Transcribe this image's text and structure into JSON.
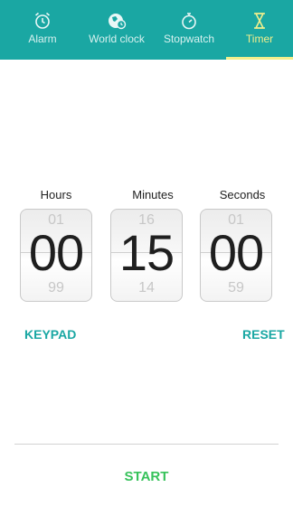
{
  "tabs": [
    {
      "label": "Alarm",
      "icon": "alarm-clock-icon"
    },
    {
      "label": "World clock",
      "icon": "globe-clock-icon"
    },
    {
      "label": "Stopwatch",
      "icon": "stopwatch-icon"
    },
    {
      "label": "Timer",
      "icon": "hourglass-icon",
      "active": true
    }
  ],
  "timer": {
    "hours": {
      "label": "Hours",
      "prev": "01",
      "value": "00",
      "next": "99"
    },
    "minutes": {
      "label": "Minutes",
      "prev": "16",
      "value": "15",
      "next": "14"
    },
    "seconds": {
      "label": "Seconds",
      "prev": "01",
      "value": "00",
      "next": "59"
    }
  },
  "actions": {
    "keypad": "KEYPAD",
    "reset": "RESET",
    "start": "START"
  },
  "colors": {
    "tabbar": "#1aa7a3",
    "active_tab": "#f2ef8c",
    "accent": "#1aa7a3",
    "start": "#36c25a"
  }
}
